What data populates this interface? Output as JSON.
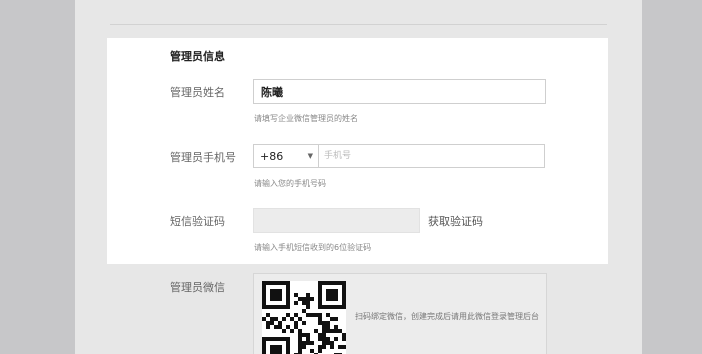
{
  "section": {
    "title": "管理员信息"
  },
  "admin_name": {
    "label": "管理员姓名",
    "value": "陈曦",
    "hint": "请填写企业微信管理员的姓名"
  },
  "admin_phone": {
    "label": "管理员手机号",
    "country_code": "+86",
    "placeholder": "手机号",
    "hint": "请输入您的手机号码"
  },
  "sms_code": {
    "label": "短信验证码",
    "button_label": "获取验证码",
    "hint": "请输入手机短信收到的6位验证码"
  },
  "admin_wechat": {
    "label": "管理员微信",
    "qr_caption": "扫码绑定微信，创建完成后请用此微信登录管理后台"
  },
  "icons": {
    "caret": "chevron-down-icon",
    "qr": "qr-code-icon"
  },
  "colors": {
    "page_background": "#e7e7e7",
    "outer_background": "#c7c7c9",
    "card_background": "#ffffff"
  }
}
